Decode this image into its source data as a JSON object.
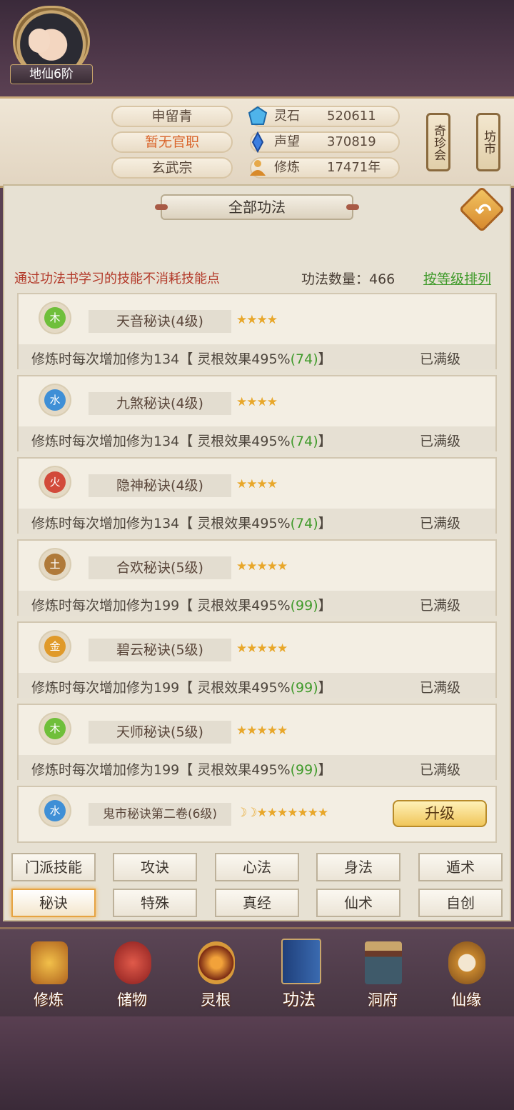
{
  "player": {
    "name": "申留青",
    "official": "暂无官职",
    "sect": "玄武宗",
    "rank": "地仙6阶"
  },
  "resources": [
    {
      "icon": "spirit-stone-icon",
      "label": "灵石",
      "value": "520611"
    },
    {
      "icon": "prestige-icon",
      "label": "声望",
      "value": "370819"
    },
    {
      "icon": "cultivation-icon",
      "label": "修炼",
      "value": "17471年"
    }
  ],
  "side_buttons": {
    "treasure": "奇珍会",
    "market": "坊市"
  },
  "panel": {
    "title": "全部功法",
    "note": "通过功法书学习的技能不消耗技能点",
    "count": "功法数量：466",
    "sort": "按等级排列"
  },
  "skills": [
    {
      "element": "木",
      "name": "天音秘诀(4级)",
      "stars": "★★★★",
      "desc": "修炼时每次增加修为134【 灵根效果495%",
      "bonus": "(74)",
      "end": "】",
      "status": "已满级"
    },
    {
      "element": "水",
      "name": "九煞秘诀(4级)",
      "stars": "★★★★",
      "desc": "修炼时每次增加修为134【 灵根效果495%",
      "bonus": "(74)",
      "end": "】",
      "status": "已满级"
    },
    {
      "element": "火",
      "name": "隐神秘诀(4级)",
      "stars": "★★★★",
      "desc": "修炼时每次增加修为134【 灵根效果495%",
      "bonus": "(74)",
      "end": "】",
      "status": "已满级"
    },
    {
      "element": "土",
      "name": "合欢秘诀(5级)",
      "stars": "★★★★★",
      "desc": "修炼时每次增加修为199【 灵根效果495%",
      "bonus": "(99)",
      "end": "】",
      "status": "已满级"
    },
    {
      "element": "金",
      "name": "碧云秘诀(5级)",
      "stars": "★★★★★",
      "desc": "修炼时每次增加修为199【 灵根效果495%",
      "bonus": "(99)",
      "end": "】",
      "status": "已满级"
    },
    {
      "element": "木",
      "name": "天师秘诀(5级)",
      "stars": "★★★★★",
      "desc": "修炼时每次增加修为199【 灵根效果495%",
      "bonus": "(99)",
      "end": "】",
      "status": "已满级"
    },
    {
      "element": "水",
      "name": "鬼市秘诀第二卷(6级)",
      "stars": "☽☽★★★★★★★",
      "upgrade": "升级"
    }
  ],
  "element_colors": {
    "木": "#6fbf3a",
    "水": "#3f8fd6",
    "火": "#d24a3a",
    "土": "#b07a3a",
    "金": "#e09a2a"
  },
  "categories": [
    "门派技能",
    "攻诀",
    "心法",
    "身法",
    "遁术",
    "秘诀",
    "特殊",
    "真经",
    "仙术",
    "自创"
  ],
  "selected_category": "秘诀",
  "bottom_nav": [
    {
      "icon": "meditation-icon",
      "label": "修炼"
    },
    {
      "icon": "storage-bag-icon",
      "label": "储物"
    },
    {
      "icon": "spirit-root-icon",
      "label": "灵根"
    },
    {
      "icon": "skill-book-icon",
      "label": "功法"
    },
    {
      "icon": "cave-mansion-icon",
      "label": "洞府"
    },
    {
      "icon": "immortal-fate-icon",
      "label": "仙缘"
    }
  ]
}
